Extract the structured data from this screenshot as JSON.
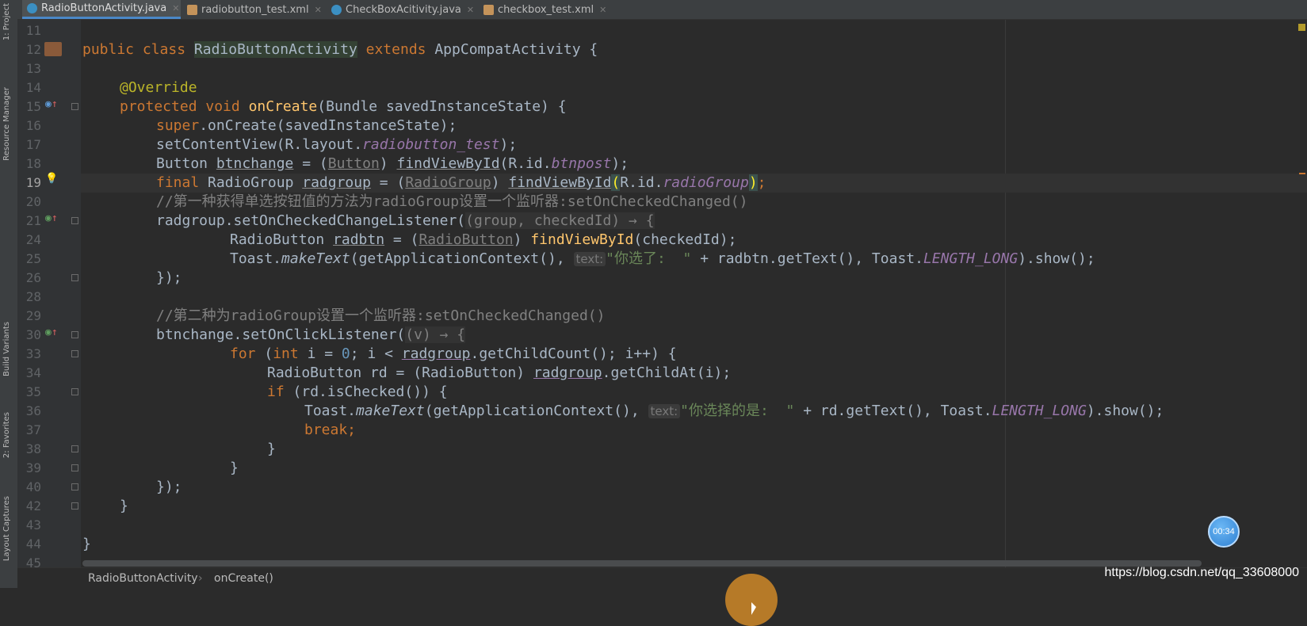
{
  "tabs": [
    {
      "label": "RadioButtonActivity.java",
      "type": "java",
      "active": true
    },
    {
      "label": "radiobutton_test.xml",
      "type": "xml",
      "active": false
    },
    {
      "label": "CheckBoxAcitivity.java",
      "type": "java",
      "active": false
    },
    {
      "label": "checkbox_test.xml",
      "type": "xml",
      "active": false
    }
  ],
  "left_tools": [
    "1: Project",
    "Resource Manager",
    "Build Variants",
    "2: Favorites",
    "Layout Captures"
  ],
  "line_numbers": [
    "11",
    "12",
    "13",
    "14",
    "15",
    "16",
    "17",
    "18",
    "19",
    "20",
    "21",
    "24",
    "25",
    "26",
    "28",
    "29",
    "30",
    "33",
    "34",
    "35",
    "36",
    "37",
    "38",
    "39",
    "40",
    "42",
    "43",
    "44",
    "45"
  ],
  "current_line": "19",
  "code": {
    "l12": {
      "kw1": "public class ",
      "cls": "RadioButtonActivity",
      "kw2": " extends ",
      "base": "AppCompatActivity {"
    },
    "l14": {
      "ann": "@Override"
    },
    "l15": {
      "kw": "protected void ",
      "fn": "onCreate",
      "rest": "(Bundle savedInstanceState) {"
    },
    "l16": {
      "kw": "super",
      "rest": ".onCreate(savedInstanceState);"
    },
    "l17": {
      "a": "setContentView(R.layout.",
      "fld": "radiobutton_test",
      "b": ");"
    },
    "l18": {
      "a": "Button ",
      "var": "btnchange",
      "b": " = (",
      "cast": "Button",
      "c": ") ",
      "fn": "findViewById",
      "d": "(R.id.",
      "fld": "btnpost",
      "e": ");"
    },
    "l19": {
      "kw": "final ",
      "a": "RadioGroup ",
      "var": "radgroup",
      "b": " = (",
      "cast": "RadioGroup",
      "c": ") ",
      "fn": "findViewById",
      "d": "(",
      "e": "R.id.",
      "fld": "radioGroup",
      "f": ")",
      "g": ";"
    },
    "l20": {
      "comment": "//第一种获得单选按钮值的方法为radioGroup设置一个监听器:setOnCheckedChanged()"
    },
    "l21": {
      "a": "radgroup.setOnCheckedChangeListener(",
      "lambda": "(group, checkedId) → {"
    },
    "l24": {
      "a": "RadioButton ",
      "var": "radbtn",
      "b": " = (",
      "cast": "RadioButton",
      "c": ") ",
      "fn": "findViewById",
      "d": "(checkedId);"
    },
    "l25": {
      "a": "Toast.",
      "m": "makeText",
      "b": "(getApplicationContext(), ",
      "hint": "text:",
      "str": "\"你选了:  \"",
      "c": " + radbtn.getText(), Toast.",
      "fld": "LENGTH_LONG",
      "d": ").show();"
    },
    "l26": {
      "a": "});"
    },
    "l29": {
      "comment": "//第二种为radioGroup设置一个监听器:setOnCheckedChanged()"
    },
    "l30": {
      "a": "btnchange.setOnClickListener(",
      "lambda": "(v) → {"
    },
    "l33": {
      "kw": "for ",
      "a": "(",
      "kw2": "int ",
      "b": "i = ",
      "num": "0",
      "c": "; i < ",
      "var": "radgroup",
      "d": ".getChildCount(); i++) {"
    },
    "l34": {
      "a": "RadioButton rd = (RadioButton) ",
      "var": "radgroup",
      "b": ".getChildAt(i);"
    },
    "l35": {
      "kw": "if ",
      "a": "(rd.isChecked()) {"
    },
    "l36": {
      "a": "Toast.",
      "m": "makeText",
      "b": "(getApplicationContext(), ",
      "hint": "text:",
      "str": "\"你选择的是:  \"",
      "c": " + rd.getText(), Toast.",
      "fld": "LENGTH_LONG",
      "d": ").show();"
    },
    "l37": {
      "kw": "break;"
    },
    "l38": {
      "a": "}"
    },
    "l39": {
      "a": "}"
    },
    "l40": {
      "a": "});"
    },
    "l42": {
      "a": "}"
    },
    "l44": {
      "a": "}"
    }
  },
  "breadcrumb": [
    "RadioButtonActivity",
    "onCreate()"
  ],
  "breadcrumb_sep": "›",
  "watermark": "https://blog.csdn.net/qq_33608000",
  "timer": "00:34",
  "colors": {
    "keyword": "#cc7832",
    "annotation": "#bbb529",
    "method": "#ffc66d",
    "field": "#9876aa",
    "comment": "#808080",
    "number": "#6897bb",
    "string": "#6a8759"
  }
}
